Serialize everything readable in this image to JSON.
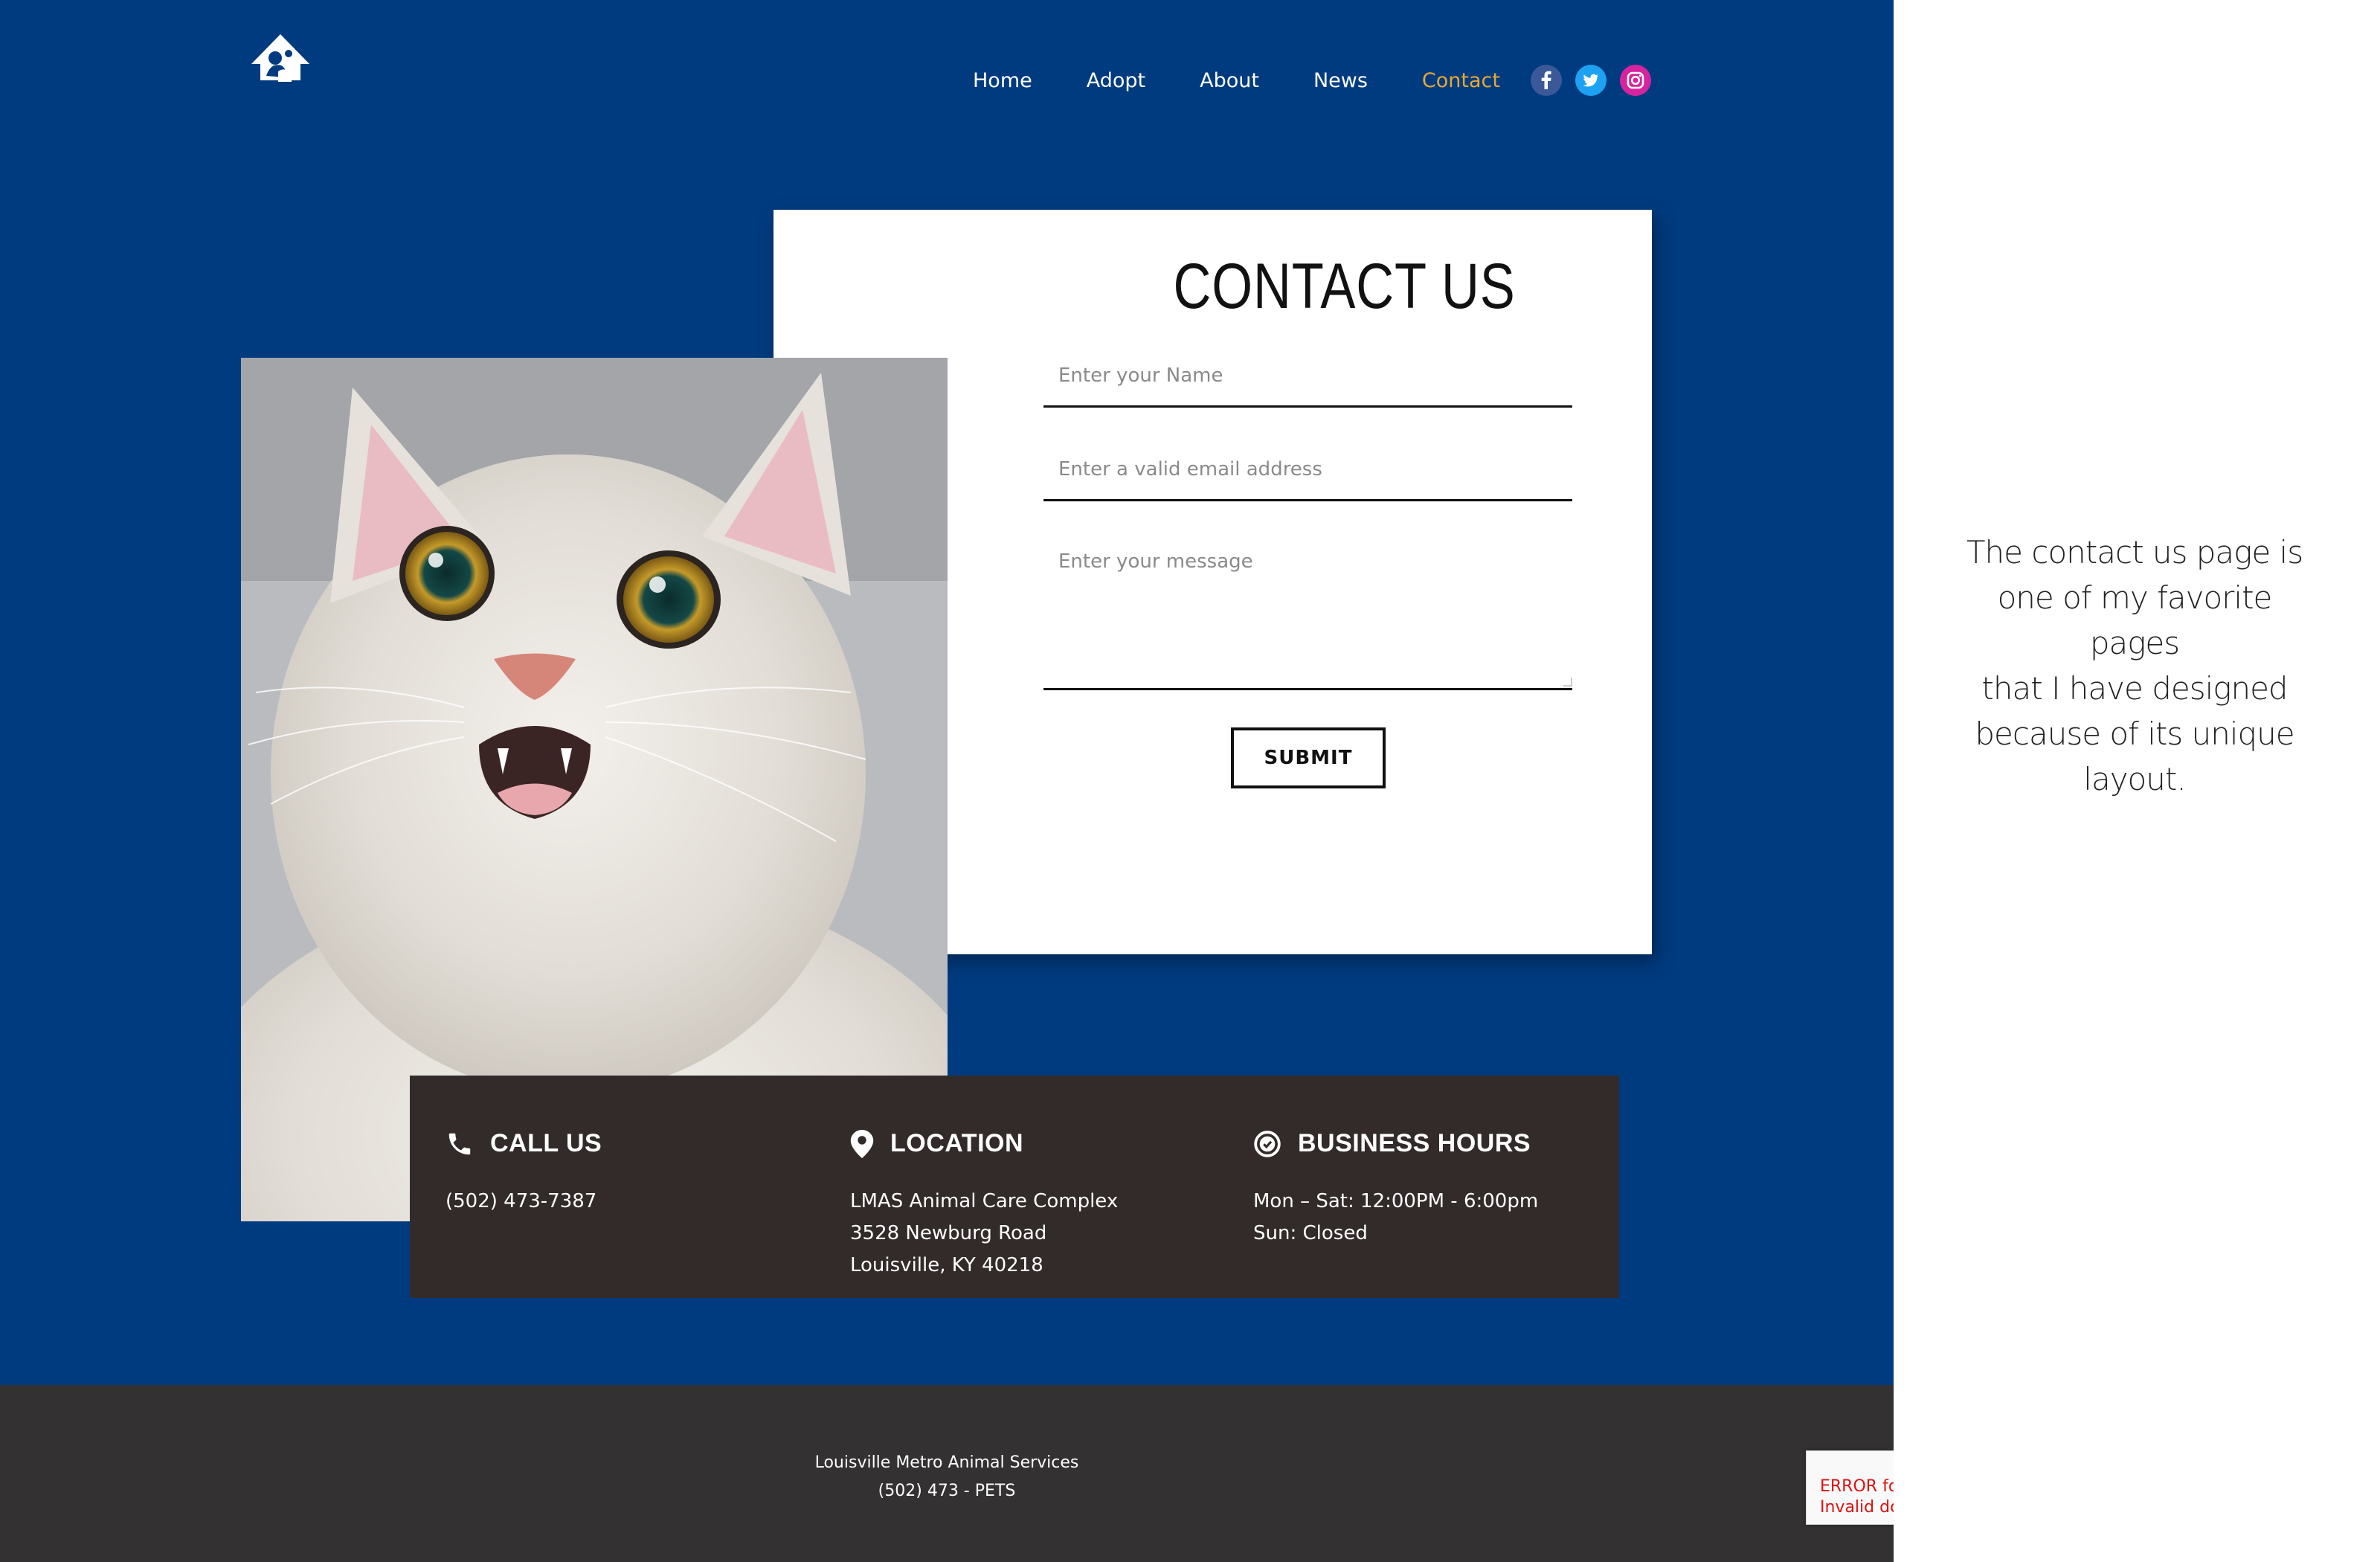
{
  "nav": {
    "items": [
      {
        "label": "Home"
      },
      {
        "label": "Adopt"
      },
      {
        "label": "About"
      },
      {
        "label": "News"
      },
      {
        "label": "Contact"
      }
    ],
    "active": "Contact",
    "social": [
      "facebook-icon",
      "twitter-icon",
      "instagram-icon"
    ]
  },
  "contact": {
    "title": "CONTACT US",
    "name_placeholder": "Enter your Name",
    "email_placeholder": "Enter a valid email address",
    "message_placeholder": "Enter your message",
    "submit_label": "SUBMIT"
  },
  "info": {
    "call": {
      "title": "CALL US",
      "phone": "(502) 473-7387"
    },
    "location": {
      "title": "LOCATION",
      "line1": "LMAS Animal Care Complex",
      "line2": "3528 Newburg Road",
      "line3": "Louisville, KY 40218"
    },
    "hours": {
      "title": "BUSINESS HOURS",
      "line1": "Mon – Sat: 12:00PM - 6:00pm",
      "line2": "Sun: Closed"
    }
  },
  "footer": {
    "org": "Louisville Metro Animal Services",
    "phone": "(502) 473 - PETS"
  },
  "recaptcha": {
    "line1": "ERROR fo",
    "line2": "Invalid do"
  },
  "side_note": {
    "line1": "The contact us page is",
    "line2": "one of my favorite pages",
    "line3": "that I have designed",
    "line4": "because of its unique",
    "line5": "layout."
  },
  "colors": {
    "page_blue": "#003b7f",
    "info_bar": "#332b29",
    "footer": "#333131",
    "nav_active": "#e6a837"
  }
}
